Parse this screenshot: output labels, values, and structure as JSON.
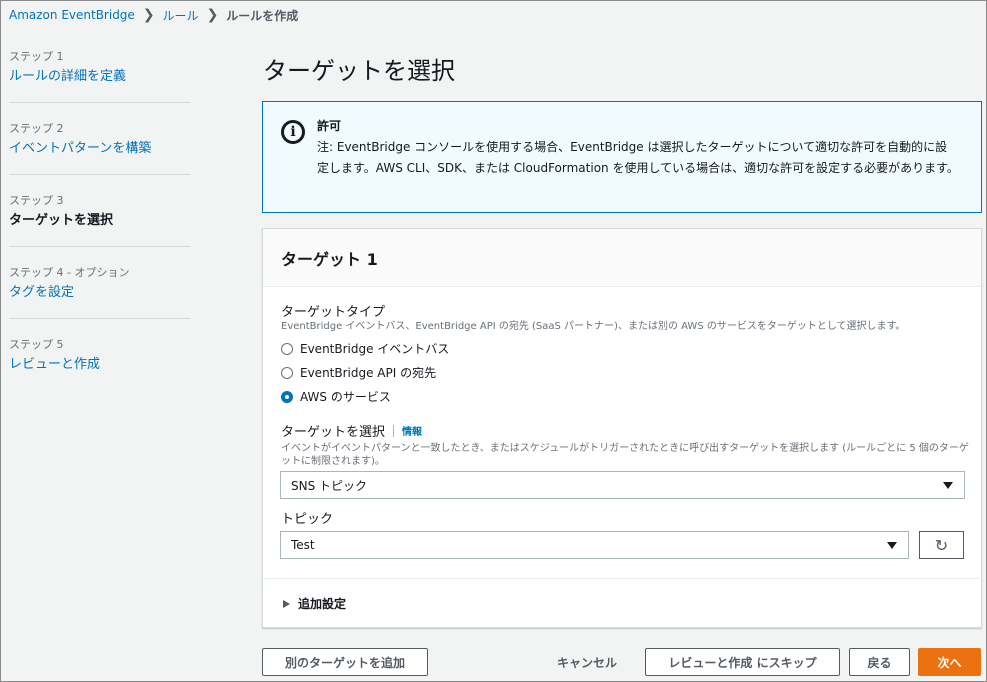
{
  "breadcrumb": {
    "items": [
      "Amazon EventBridge",
      "ルール",
      "ルールを作成"
    ]
  },
  "steps": [
    {
      "num": "ステップ 1",
      "name": "ルールの詳細を定義"
    },
    {
      "num": "ステップ 2",
      "name": "イベントパターンを構築"
    },
    {
      "num": "ステップ 3",
      "name": "ターゲットを選択"
    },
    {
      "num": "ステップ 4 - オプション",
      "name": "タグを設定"
    },
    {
      "num": "ステップ 5",
      "name": "レビューと作成"
    }
  ],
  "page_title": "ターゲットを選択",
  "alert": {
    "icon": "info-icon",
    "title": "許可",
    "body": "注: EventBridge コンソールを使用する場合、EventBridge は選択したターゲットについて適切な許可を自動的に設定します。AWS CLI、SDK、または CloudFormation を使用している場合は、適切な許可を設定する必要があります。"
  },
  "panel": {
    "header": "ターゲット 1",
    "target_type": {
      "label": "ターゲットタイプ",
      "description": "EventBridge イベントバス、EventBridge API の宛先 (SaaS パートナー)、または別の AWS のサービスをターゲットとして選択します。",
      "options": [
        {
          "label": "EventBridge イベントバス",
          "checked": false
        },
        {
          "label": "EventBridge API の宛先",
          "checked": false
        },
        {
          "label": "AWS のサービス",
          "checked": true
        }
      ]
    },
    "select_target": {
      "label": "ターゲットを選択",
      "info": "情報",
      "description": "イベントがイベントパターンと一致したとき、またはスケジュールがトリガーされたときに呼び出すターゲットを選択します (ルールごとに 5 個のターゲットに制限されます)。",
      "value": "SNS トピック"
    },
    "topic": {
      "label": "トピック",
      "value": "Test"
    },
    "additional_settings": "追加設定"
  },
  "footer": {
    "add_target": "別のターゲットを追加",
    "cancel": "キャンセル",
    "skip_to_review": "レビューと作成 にスキップ",
    "back": "戻る",
    "next": "次へ"
  },
  "colors": {
    "link": "#0073bb",
    "primary": "#ec7211",
    "alert_bg": "#f1faff"
  }
}
